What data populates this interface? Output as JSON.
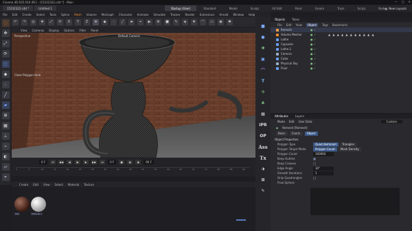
{
  "window": {
    "title": "Cinema 4D R25.010 (RC) - [15232322.c4d *] - Main",
    "controls": [
      "—",
      "□",
      "✕"
    ]
  },
  "file_tabs": [
    "15232322.c4d *",
    "Untitled 1"
  ],
  "layout_tabs": [
    "Startup (User)",
    "Standard",
    "Model",
    "Sculpt",
    "UV Edit",
    "Paint",
    "Groom",
    "Track",
    "Script",
    "Nodes"
  ],
  "active_layout": "Startup (User)",
  "new_layouts": "New Layouts",
  "menu": [
    "File",
    "Edit",
    "Create",
    "Select",
    "Tools",
    "Spline",
    "Mesh",
    "Volume",
    "MoGraph",
    "Character",
    "Animate",
    "Simulate",
    "Tracker",
    "Render",
    "Extensions",
    "Arnold",
    "Window",
    "Help"
  ],
  "menu_highlight": "Mesh",
  "view_menu": [
    "View",
    "Cameras",
    "Display",
    "Options",
    "Filter",
    "Panel"
  ],
  "viewport": {
    "label_left": "Perspective",
    "label_center": "Default Camera",
    "hud": "Close Polygon Hole"
  },
  "timeline": {
    "frame": "0 F",
    "start": "0 F",
    "end": "90 F",
    "end_field": "90 F",
    "ticks": [
      "0",
      "5",
      "10",
      "15",
      "20",
      "25",
      "30",
      "35",
      "40",
      "45",
      "50",
      "55",
      "60",
      "65",
      "70",
      "75",
      "80",
      "85",
      "90"
    ]
  },
  "material_menu": [
    "Create",
    "Edit",
    "View",
    "Select",
    "Material",
    "Texture"
  ],
  "materials": [
    {
      "label": "Mat"
    },
    {
      "label": "Material.1"
    }
  ],
  "objects_panel": {
    "tabs": [
      "Objects",
      "Takes"
    ],
    "menu": [
      "File",
      "Edit",
      "View",
      "Object",
      "Tags",
      "Bookmarks"
    ],
    "selected_menu": "Object",
    "items": [
      {
        "name": "Remesh",
        "color": "#f0a040",
        "selected": true
      },
      {
        "name": "Volume Mesher",
        "color": "#f08a2a",
        "selected": false
      },
      {
        "name": "Lathe",
        "color": "#6aa0ff",
        "selected": false
      },
      {
        "name": "Capsules",
        "color": "#6aa0ff",
        "selected": false
      },
      {
        "name": "Lathe.1",
        "color": "#6aa0ff",
        "selected": false
      },
      {
        "name": "Camera",
        "color": "#9ab0c8",
        "selected": false
      },
      {
        "name": "Cube",
        "color": "#6aa0ff",
        "selected": false
      },
      {
        "name": "Physical Sky",
        "color": "#9ab0c8",
        "selected": false
      },
      {
        "name": "Floor",
        "color": "#6aa0ff",
        "selected": false
      }
    ]
  },
  "attributes_panel": {
    "tabs": [
      "Attributes",
      "Layers"
    ],
    "menu": [
      "Mode",
      "Edit",
      "User Data"
    ],
    "object_name": "Remesh [Remesh]",
    "mode_value": "Custom",
    "sub_tabs": [
      "Basic",
      "Coord.",
      "Object"
    ],
    "active_sub_tab": "Object",
    "section": "Object Properties",
    "props": [
      {
        "label": "Polygon Type",
        "buttons": [
          "Quad dominant",
          "Triangles"
        ],
        "active": "Quad dominant"
      },
      {
        "label": "Polygon Target Mode",
        "buttons": [
          "Polygon Count",
          "Mesh Density"
        ],
        "active": "Polygon Count"
      },
      {
        "label": "Polygon Count",
        "value": "100000"
      },
      {
        "label": "Keep Outline",
        "check": true
      },
      {
        "label": "Keep Creases",
        "check": false
      },
      {
        "label": "Edge Angle",
        "value": "30°"
      },
      {
        "label": "Smooth Iterations",
        "value": "1"
      },
      {
        "label": "Only Quadrangles",
        "check": false
      },
      {
        "label": "Flow Splines",
        "value": ""
      }
    ]
  },
  "right_strip_icons": [
    "cube-icon",
    "sphere-icon",
    "light-icon",
    "camera-icon",
    "deformer-icon",
    "spline-icon",
    "mograph-icon",
    "field-icon",
    "text-icon",
    "ipr-icon",
    "op-icon",
    "asset-icon",
    "tx-icon"
  ]
}
